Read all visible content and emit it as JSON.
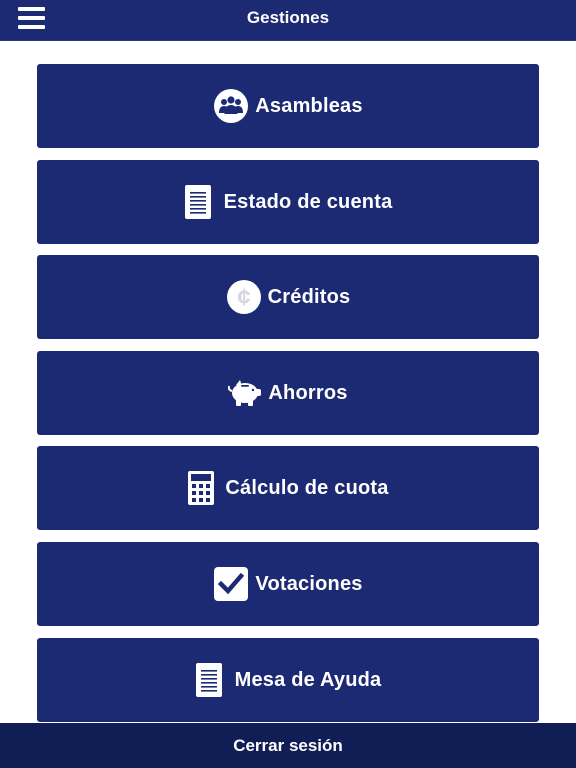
{
  "header": {
    "title": "Gestiones",
    "menu_icon": "hamburger-menu-icon"
  },
  "menu": {
    "items": [
      {
        "label": "Asambleas",
        "icon": "people-group-icon"
      },
      {
        "label": "Estado de cuenta",
        "icon": "document-icon"
      },
      {
        "label": "Créditos",
        "icon": "colon-currency-icon"
      },
      {
        "label": "Ahorros",
        "icon": "piggy-bank-icon"
      },
      {
        "label": "Cálculo de cuota",
        "icon": "calculator-icon"
      },
      {
        "label": "Votaciones",
        "icon": "checkbox-icon"
      },
      {
        "label": "Mesa de Ayuda",
        "icon": "document-icon"
      }
    ]
  },
  "footer": {
    "logout_label": "Cerrar sesión"
  },
  "colors": {
    "primary": "#1b2a73",
    "footer": "#111d55",
    "background": "#ffffff",
    "text": "#ffffff"
  }
}
